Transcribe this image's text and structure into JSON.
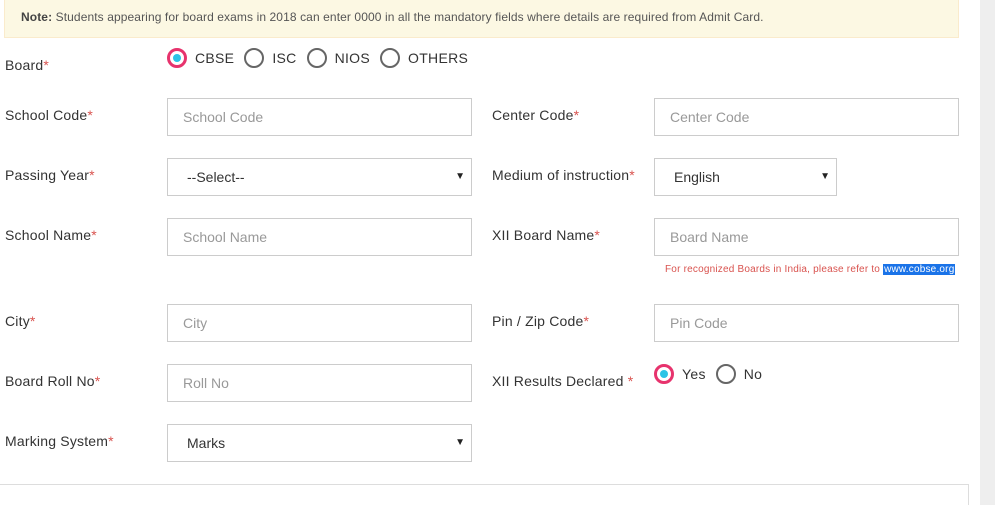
{
  "note": {
    "title": "Note:",
    "text": "Students appearing for board exams in 2018 can enter 0000 in all the mandatory fields where details are required from Admit Card."
  },
  "required_mark": "*",
  "board": {
    "label": "Board",
    "options": [
      "CBSE",
      "ISC",
      "NIOS",
      "OTHERS"
    ],
    "selected": "CBSE"
  },
  "school_code": {
    "label": "School Code",
    "placeholder": "School Code"
  },
  "center_code": {
    "label": "Center Code",
    "placeholder": "Center Code"
  },
  "passing_year": {
    "label": "Passing Year",
    "value": "--Select--"
  },
  "medium": {
    "label": "Medium of instruction",
    "value": "English"
  },
  "school_name": {
    "label": "School Name",
    "placeholder": "School Name"
  },
  "xii_board_name": {
    "label": "XII Board Name",
    "placeholder": "Board Name",
    "hint": "For recognized Boards in India, please refer to",
    "hint_link": "www.cobse.org"
  },
  "city": {
    "label": "City",
    "placeholder": "City"
  },
  "pin": {
    "label": "Pin / Zip Code",
    "placeholder": "Pin Code"
  },
  "roll_no": {
    "label": "Board Roll No",
    "placeholder": "Roll No"
  },
  "results_declared": {
    "label": "XII Results Declared ",
    "options": [
      "Yes",
      "No"
    ],
    "selected": "Yes"
  },
  "marking_system": {
    "label": "Marking System",
    "value": "Marks"
  },
  "caret": "▼",
  "colors": {
    "accent": "#e7336d",
    "radio_dot": "#2bc4e6",
    "required": "#d9534f",
    "note_bg": "#fcf8e3"
  }
}
